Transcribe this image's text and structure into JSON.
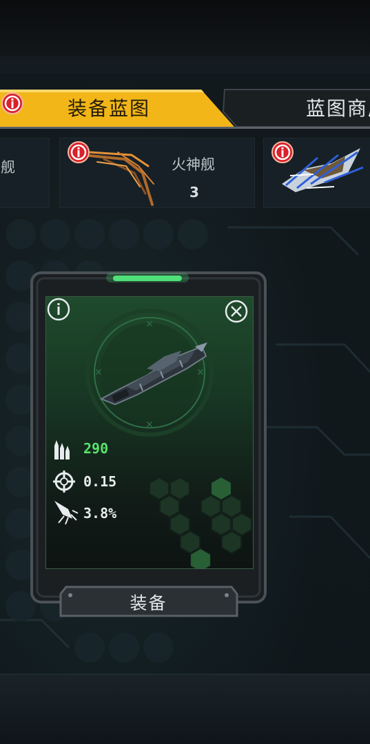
{
  "tabs": [
    {
      "label": "装备蓝图",
      "active": true
    },
    {
      "label": "蓝图商店",
      "active": false
    }
  ],
  "ships": [
    {
      "name": "舰",
      "count": ""
    },
    {
      "name": "火神舰",
      "count": "3"
    },
    {
      "name": "",
      "count": ""
    }
  ],
  "equipment": {
    "stats": [
      {
        "icon": "ammo-icon",
        "value": "290",
        "highlight": true
      },
      {
        "icon": "crosshair-icon",
        "value": "0.15",
        "highlight": false
      },
      {
        "icon": "rocket-icon",
        "value": "3.8%",
        "highlight": false
      }
    ],
    "action_label": "装备"
  },
  "colors": {
    "tab_active": "#f2b619",
    "tab_inactive": "#1a1f22",
    "alert": "#d8212b",
    "stat_highlight": "#5ae36a",
    "card_green": "#1f4a2c",
    "glow": "#4fe07a"
  }
}
